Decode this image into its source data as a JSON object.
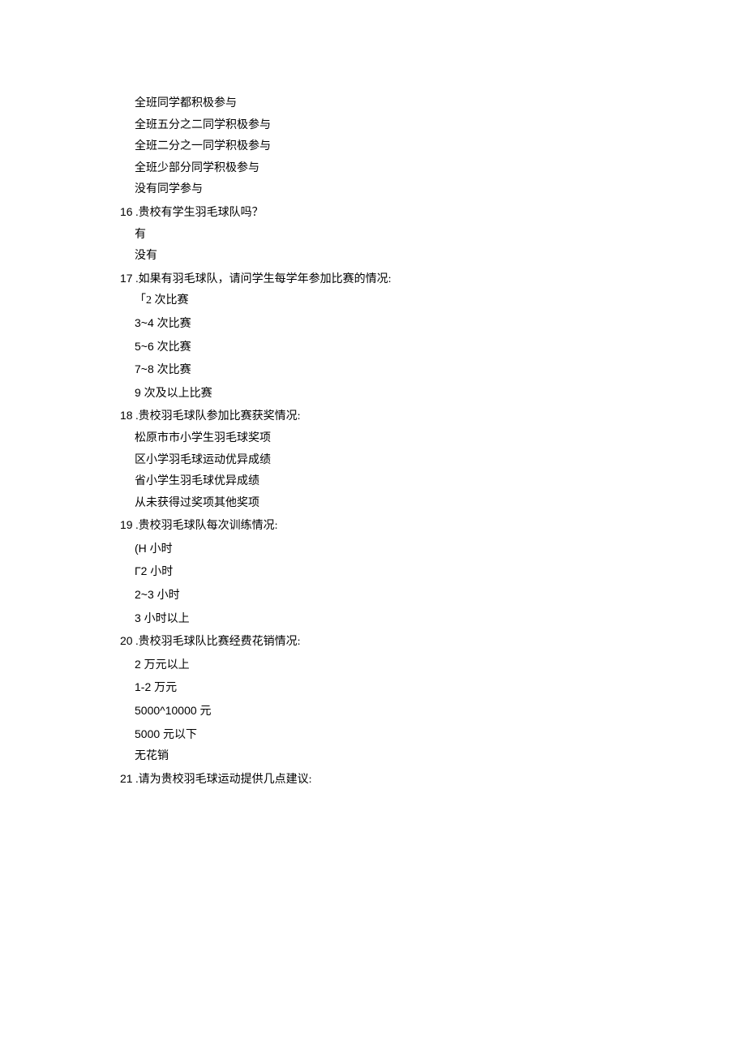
{
  "q15_options": [
    "全班同学都积极参与",
    "全班五分之二同学积极参与",
    "全班二分之一同学积极参与",
    "全班少部分同学积极参与",
    "没有同学参与"
  ],
  "q16": {
    "num": "16",
    "text": " .贵校有学生羽毛球队吗？",
    "options": [
      "有",
      "没有"
    ]
  },
  "q17": {
    "num": "17",
    "text": " .如果有羽毛球队，请问学生每学年参加比赛的情况:",
    "options": [
      "「2 次比赛",
      "3~4 次比赛",
      "5~6 次比赛",
      "7~8 次比赛",
      "9 次及以上比赛"
    ]
  },
  "q18": {
    "num": "18",
    "text": " .贵校羽毛球队参加比赛获奖情况:",
    "options": [
      "松原市市小学生羽毛球奖项",
      "区小学羽毛球运动优异成绩",
      "省小学生羽毛球优异成绩",
      "从未获得过奖项其他奖项"
    ]
  },
  "q19": {
    "num": "19",
    "text": " .贵校羽毛球队每次训练情况:",
    "options": [
      "(H 小时",
      "Г2 小时",
      "2~3 小时",
      "3 小时以上"
    ]
  },
  "q20": {
    "num": "20",
    "text": " .贵校羽毛球队比赛经费花销情况:",
    "options": [
      "2 万元以上",
      "1-2 万元",
      "5000^10000 元",
      "5000 元以下",
      "无花销"
    ]
  },
  "q21": {
    "num": "21",
    "text": " .请为贵校羽毛球运动提供几点建议:"
  }
}
